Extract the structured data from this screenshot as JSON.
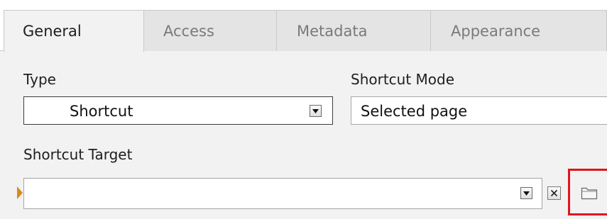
{
  "tabs": [
    {
      "label": "General",
      "active": true
    },
    {
      "label": "Access",
      "active": false
    },
    {
      "label": "Metadata",
      "active": false
    },
    {
      "label": "Appearance",
      "active": false
    }
  ],
  "fields": {
    "type": {
      "label": "Type",
      "value": "Shortcut"
    },
    "shortcut_mode": {
      "label": "Shortcut Mode",
      "value": "Selected page"
    },
    "shortcut_target": {
      "label": "Shortcut Target",
      "value": ""
    }
  },
  "icons": {
    "dropdown": "chevron-down-icon",
    "clear": "close-icon",
    "browse": "folder-icon"
  },
  "colors": {
    "highlight": "#e3141d",
    "marker": "#d8891e",
    "panel_bg": "#f2f2f2"
  }
}
